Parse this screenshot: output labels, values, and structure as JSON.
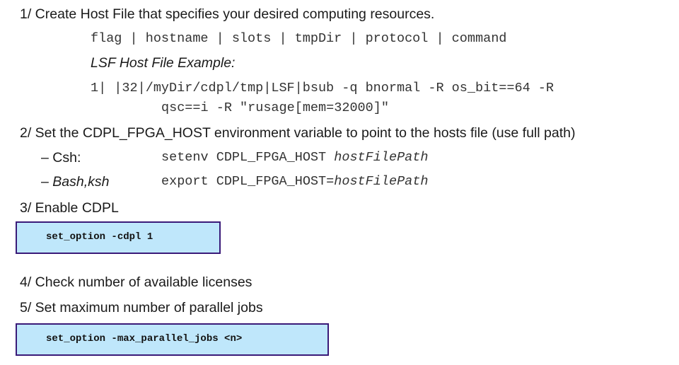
{
  "step1": {
    "heading": "1/ Create Host File that specifies your desired computing resources.",
    "fields": "flag | hostname | slots | tmpDir | protocol | command",
    "example_label": "LSF Host File Example:",
    "example_line1": "1| |32|/myDir/cdpl/tmp|LSF|bsub -q bnormal -R os_bit==64 -R",
    "example_line2": "qsc==i -R \"rusage[mem=32000]\""
  },
  "step2": {
    "heading": "2/ Set the CDPL_FPGA_HOST environment variable to point to the hosts file (use full path)",
    "csh_label": "– Csh:",
    "csh_cmd": "setenv CDPL_FPGA_HOST ",
    "csh_arg": "hostFilePath",
    "bash_dash": "– ",
    "bash_label": "Bash,ksh",
    "bash_cmd": "export CDPL_FPGA_HOST=",
    "bash_arg": "hostFilePath"
  },
  "step3": {
    "heading": "3/ Enable CDPL",
    "command": "set_option -cdpl 1"
  },
  "step4": {
    "heading": "4/ Check number of available licenses"
  },
  "step5": {
    "heading": "5/ Set maximum number of parallel jobs",
    "command": "set_option -max_parallel_jobs <n>"
  },
  "colors": {
    "box_fill": "#bfe7fb",
    "box_border": "#3a1a78",
    "text": "#1a1a1a"
  }
}
